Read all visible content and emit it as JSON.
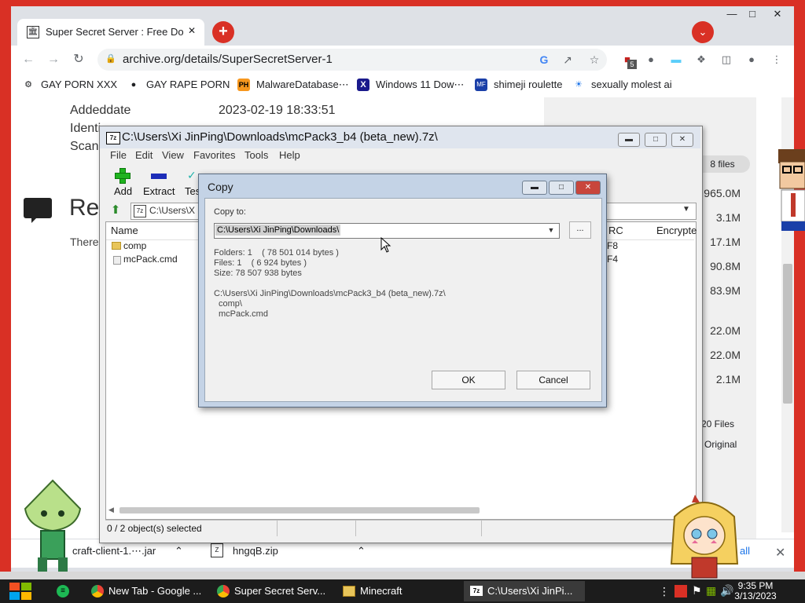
{
  "browser": {
    "tab_title": "Super Secret Server : Free Do",
    "url": "archive.org/details/SuperSecretServer-1",
    "extension_badge": "5",
    "bookmarks": [
      {
        "label": "GAY PORN XXX",
        "icon": "globe-icon"
      },
      {
        "label": "GAY RAPE PORN",
        "icon": "globe-icon"
      },
      {
        "label": "MalwareDatabase⋯",
        "icon": "ph-icon"
      },
      {
        "label": "Windows 11 Dow⋯",
        "icon": "x-icon"
      },
      {
        "label": "shimeji roulette",
        "icon": "mf-icon"
      },
      {
        "label": "sexually molest ai",
        "icon": "ai-icon"
      }
    ],
    "bookmark_icon_text": {
      "ph": "PH",
      "mf": "MF",
      "x": "X",
      "ai": "☀"
    }
  },
  "page": {
    "meta": [
      {
        "key": "Addeddate",
        "value": "2023-02-19 18:33:51"
      },
      {
        "key": "Identi",
        "value": ""
      },
      {
        "key": "Scan",
        "value": ""
      }
    ],
    "reviews_heading": "Re",
    "reviews_text": "There",
    "sidebar": {
      "files_count": "8 files",
      "sizes": [
        "965.0M",
        "3.1M",
        "17.1M",
        "90.8M",
        "83.9M",
        "22.0M",
        "22.0M",
        "2.1M"
      ],
      "total_files": "20 Files",
      "original": "Original"
    }
  },
  "downloads": [
    {
      "name": "craft-client-1.⋯.jar"
    },
    {
      "name": "hngqB.zip"
    }
  ],
  "downloads_show_all": "w all",
  "sevenzip": {
    "title": "C:\\Users\\Xi JinPing\\Downloads\\mcPack3_b4 (beta_new).7z\\",
    "menu": [
      "File",
      "Edit",
      "View",
      "Favorites",
      "Tools",
      "Help"
    ],
    "toolbar": [
      "Add",
      "Extract",
      "Tes"
    ],
    "address": "C:\\Users\\X",
    "columns": {
      "name": "Name",
      "crc": "RC",
      "encrypted": "Encrypte"
    },
    "rows": [
      {
        "name": "comp",
        "crc": "F8"
      },
      {
        "name": "mcPack.cmd",
        "crc": "F4"
      }
    ],
    "status": "0 / 2 object(s) selected"
  },
  "copy_dialog": {
    "title": "Copy",
    "copy_to_label": "Copy to:",
    "destination": "C:\\Users\\Xi JinPing\\Downloads\\",
    "browse_label": "...",
    "folders": "Folders: 1    ( 78 501 014 bytes )",
    "files": "Files: 1    ( 6 924 bytes )",
    "size": "Size: 78 507 938 bytes",
    "source_path": "C:\\Users\\Xi JinPing\\Downloads\\mcPack3_b4 (beta_new).7z\\",
    "source_items": [
      "comp\\",
      "mcPack.cmd"
    ],
    "ok_label": "OK",
    "cancel_label": "Cancel"
  },
  "taskbar": {
    "items": [
      {
        "label": "New Tab - Google ...",
        "icon": "chrome-icon"
      },
      {
        "label": "Super Secret Serv...",
        "icon": "chrome-icon"
      },
      {
        "label": "Minecraft",
        "icon": "folder-icon"
      },
      {
        "label": "C:\\Users\\Xi JinPi...",
        "icon": "7zip-icon"
      }
    ],
    "time": "9:35 PM",
    "date": "3/13/2023"
  },
  "colors": {
    "chrome_accent": "#d93025",
    "sevenzip_title": "#dfe5ee",
    "dialog_frame": "#c4d3e6"
  }
}
